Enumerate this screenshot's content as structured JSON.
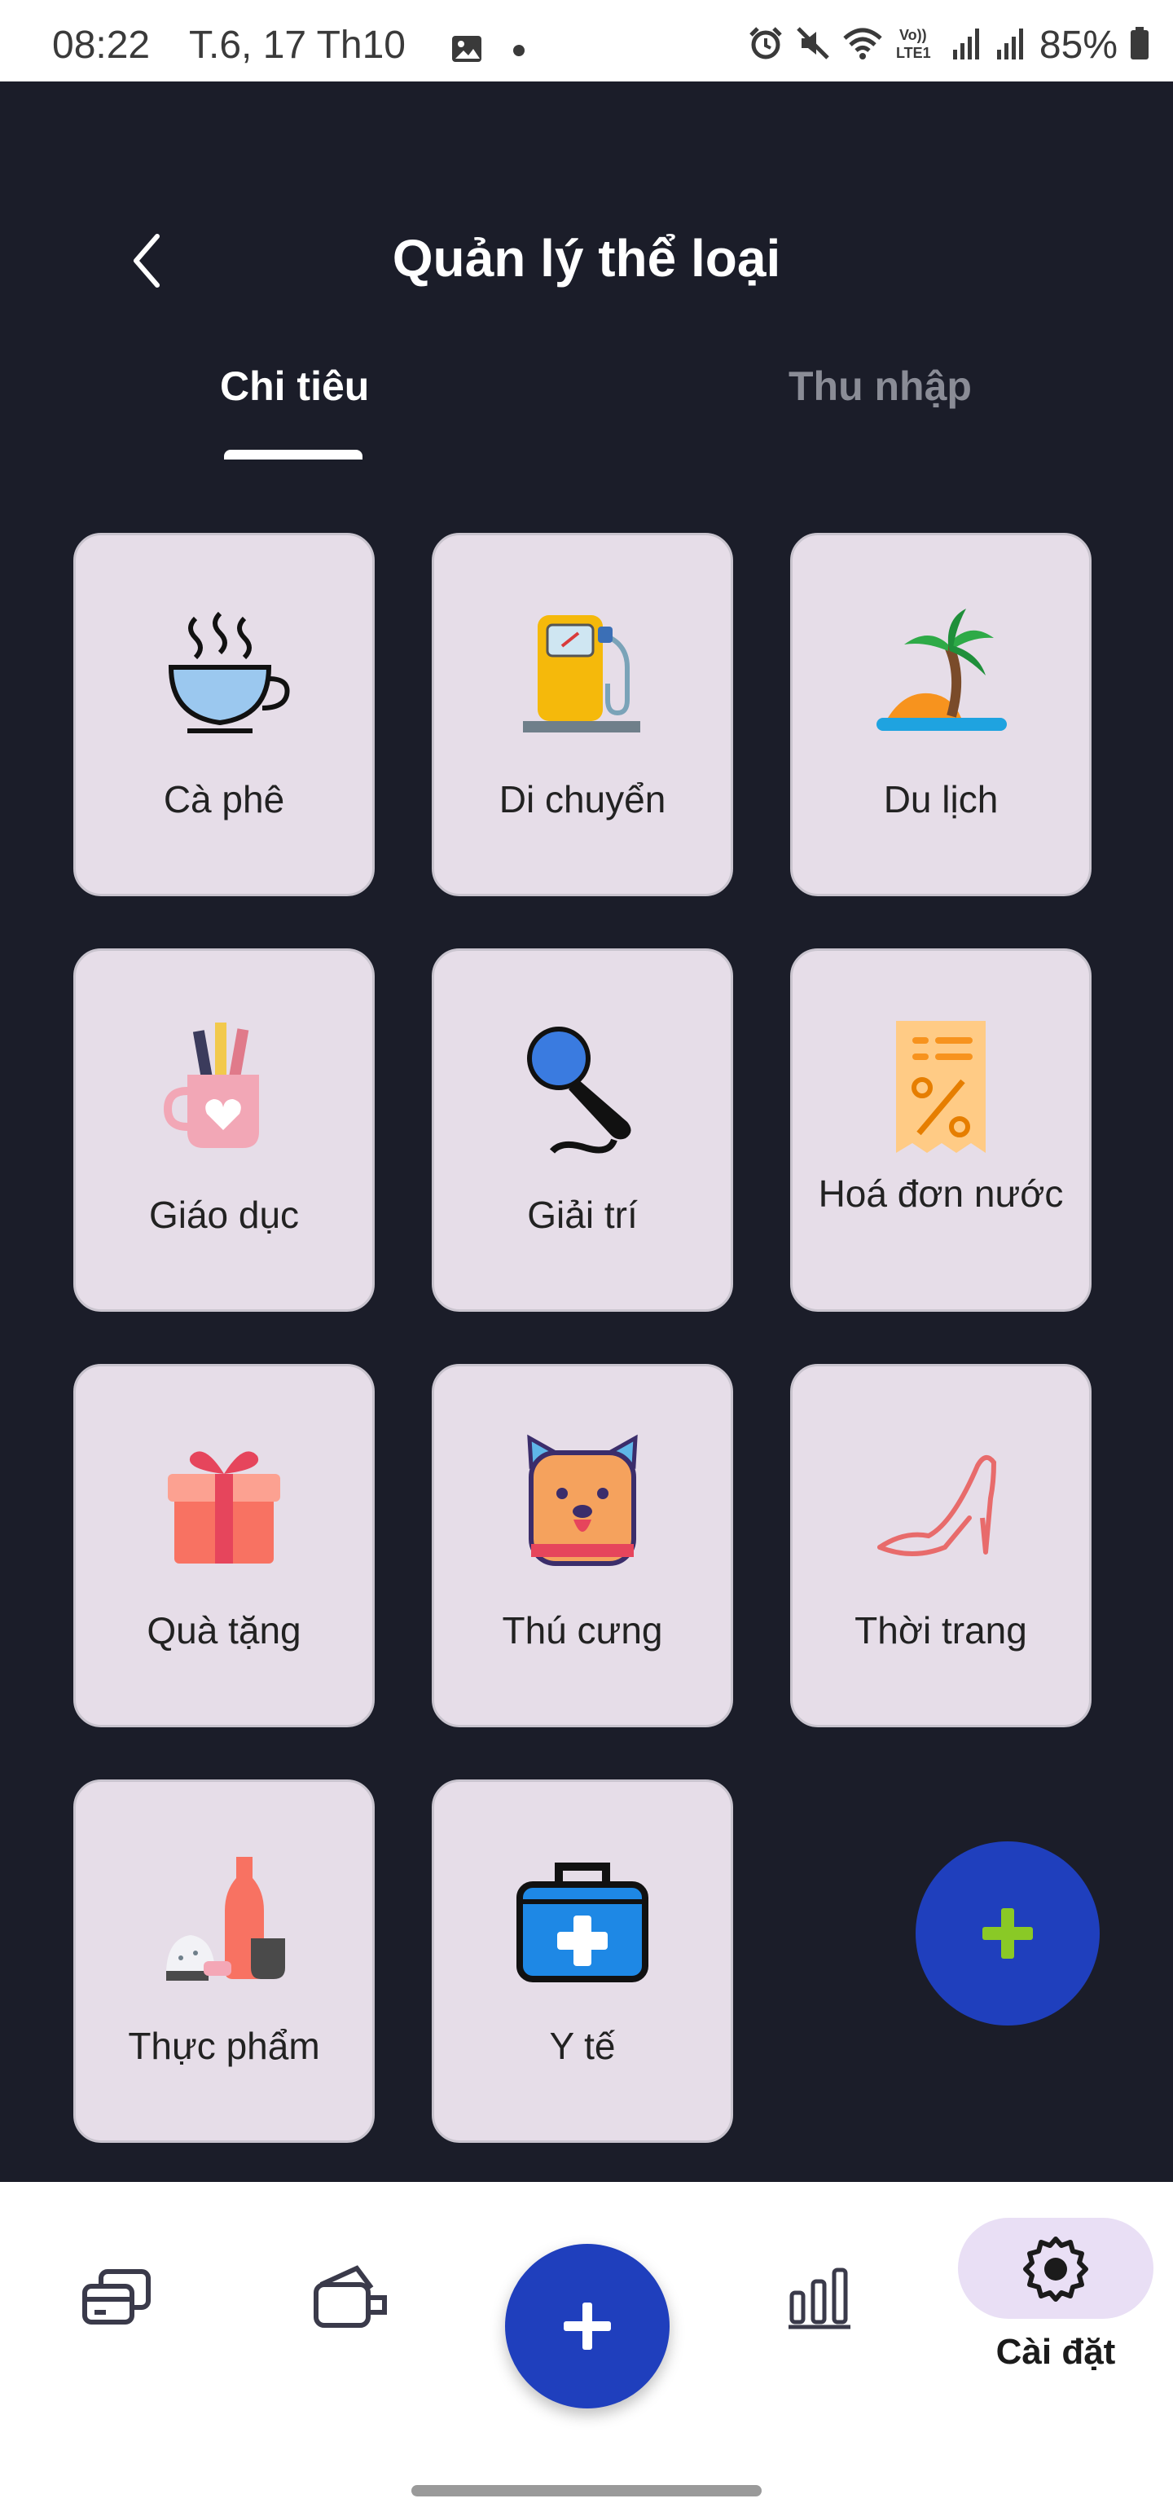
{
  "status_bar": {
    "time": "08:22",
    "date": "T.6, 17 Th10",
    "battery": "85%"
  },
  "header": {
    "title": "Quản lý thể loại"
  },
  "tabs": [
    {
      "label": "Chi tiêu",
      "active": true
    },
    {
      "label": "Thu nhập",
      "active": false
    }
  ],
  "categories": [
    {
      "label": "Cà phê",
      "icon": "coffee-cup-icon"
    },
    {
      "label": "Di chuyển",
      "icon": "fuel-pump-icon"
    },
    {
      "label": "Du lịch",
      "icon": "palm-island-icon"
    },
    {
      "label": "Giáo dục",
      "icon": "pencil-cup-icon"
    },
    {
      "label": "Giải trí",
      "icon": "microphone-icon"
    },
    {
      "label": "Hoá đơn nước",
      "icon": "receipt-percent-icon"
    },
    {
      "label": "Quà tặng",
      "icon": "gift-box-icon"
    },
    {
      "label": "Thú cưng",
      "icon": "pet-icon"
    },
    {
      "label": "Thời trang",
      "icon": "high-heel-icon"
    },
    {
      "label": "Thực phẩm",
      "icon": "food-bottle-icon"
    },
    {
      "label": "Y tế",
      "icon": "medical-kit-icon"
    }
  ],
  "bottom_nav": {
    "active_label": "Cài đặt"
  },
  "colors": {
    "background_dark": "#1b1d29",
    "card": "#e6dde8",
    "accent_blue": "#1f3fbd",
    "plus_green": "#8ac926",
    "active_pill": "#e9dff5"
  }
}
